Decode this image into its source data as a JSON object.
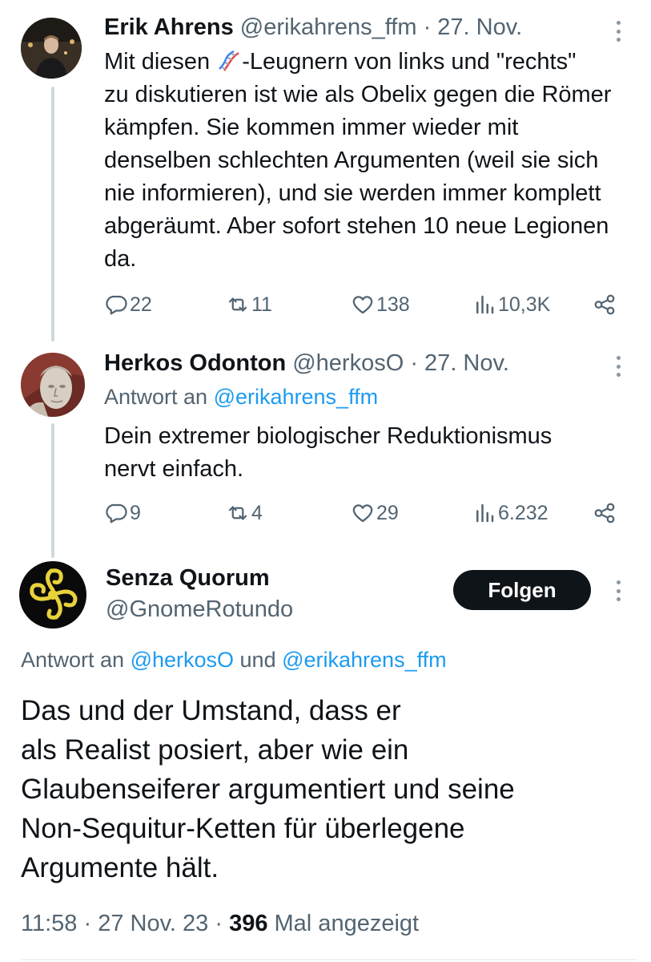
{
  "tweets": [
    {
      "name": "Erik Ahrens",
      "handle": "@erikahrens_ffm",
      "date": "· 27. Nov.",
      "text_before_icon": "Mit diesen ",
      "text_after_icon": "-Leugnern von links und \"rechts\"",
      "text_rest": "zu diskutieren ist wie als Obelix gegen die Römer kämpfen. Sie kommen immer wieder mit denselben schlechten Argumenten (weil sie sich nie informieren), und sie werden immer komplett abgeräumt. Aber sofort stehen 10 neue Legionen da.",
      "inline_icon": "dna-emoji",
      "replies": "22",
      "retweets": "11",
      "likes": "138",
      "views": "10,3K"
    },
    {
      "name": "Herkos Odonton",
      "handle": "@herkosO",
      "date": "· 27. Nov.",
      "reply_prefix": "Antwort an ",
      "reply_handle": "@erikahrens_ffm",
      "text": "Dein extremer biologischer Reduktionismus\nnervt einfach.",
      "replies": "9",
      "retweets": "4",
      "likes": "29",
      "views": "6.232"
    }
  ],
  "main_tweet": {
    "name": "Senza Quorum",
    "handle": "@GnomeRotundo",
    "follow_label": "Folgen",
    "reply_prefix": "Antwort an ",
    "reply_handle_1": "@herkosO",
    "reply_joiner": " und ",
    "reply_handle_2": "@erikahrens_ffm",
    "text": "Das und der Umstand, dass er\nals Realist posiert, aber wie ein\nGlaubenseiferer argumentiert und seine\nNon-Sequitur-Ketten für überlegene\nArgumente hält.",
    "time": "11:58 · 27 Nov. 23 · ",
    "view_count": "396",
    "view_suffix": " Mal angezeigt"
  },
  "colors": {
    "text": "#0f1419",
    "secondary": "#536471",
    "link": "#1d9bf0",
    "thread_line": "#cfd9de",
    "follow_bg": "#0f1419"
  }
}
